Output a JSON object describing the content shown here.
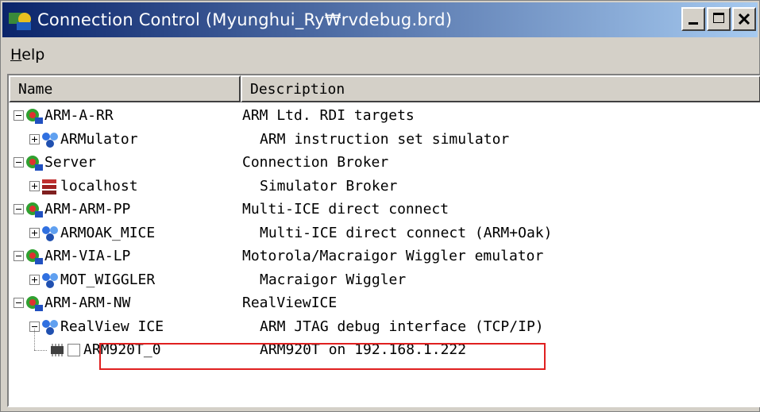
{
  "window": {
    "title": "Connection Control (Myunghui_Ry₩rvdebug.brd)"
  },
  "menu": {
    "help_label": "Help",
    "help_underline": "H",
    "help_rest": "elp"
  },
  "columns": {
    "name": "Name",
    "description": "Description"
  },
  "tree": [
    {
      "name": "ARM-A-RR",
      "description": "ARM Ltd. RDI targets",
      "level": 0,
      "expander": "minus",
      "icon": "target-icon"
    },
    {
      "name": "ARMulator",
      "description": "ARM instruction set simulator",
      "level": 1,
      "expander": "plus",
      "icon": "network-node-icon"
    },
    {
      "name": "Server",
      "description": "Connection Broker",
      "level": 0,
      "expander": "minus",
      "icon": "target-icon"
    },
    {
      "name": "localhost",
      "description": "Simulator Broker",
      "level": 1,
      "expander": "plus",
      "icon": "server-stack-icon"
    },
    {
      "name": "ARM-ARM-PP",
      "description": "Multi-ICE direct connect",
      "level": 0,
      "expander": "minus",
      "icon": "target-icon"
    },
    {
      "name": "ARMOAK_MICE",
      "description": "Multi-ICE direct connect (ARM+Oak)",
      "level": 1,
      "expander": "plus",
      "icon": "network-node-icon"
    },
    {
      "name": "ARM-VIA-LP",
      "description": "Motorola/Macraigor Wiggler emulator",
      "level": 0,
      "expander": "minus",
      "icon": "target-icon"
    },
    {
      "name": "MOT_WIGGLER",
      "description": "Macraigor Wiggler",
      "level": 1,
      "expander": "plus",
      "icon": "network-node-icon"
    },
    {
      "name": "ARM-ARM-NW",
      "description": "RealViewICE",
      "level": 0,
      "expander": "minus",
      "icon": "target-icon"
    },
    {
      "name": "RealView ICE",
      "description": "ARM JTAG debug interface (TCP/IP)",
      "level": 1,
      "expander": "minus",
      "icon": "network-node-icon"
    },
    {
      "name": "ARM920T_0",
      "description": "ARM920T on 192.168.1.222",
      "level": 2,
      "expander": "none",
      "icon": "chip-icon",
      "checkbox": false,
      "highlighted": true
    }
  ],
  "colors": {
    "title_start": "#0a246a",
    "title_end": "#a6caf0",
    "highlight_border": "#e02020",
    "face": "#d4d0c8"
  }
}
